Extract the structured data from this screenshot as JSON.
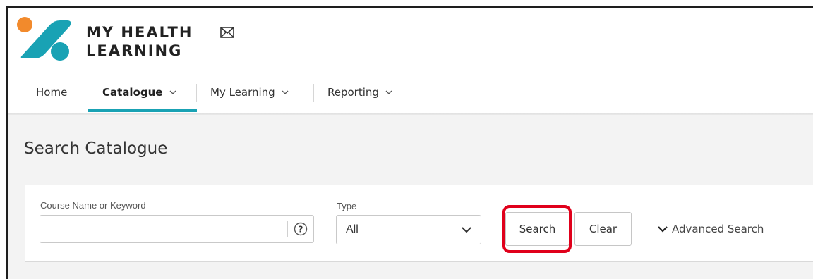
{
  "app": {
    "brand_line1": "MY HEALTH",
    "brand_line2": "LEARNING",
    "colors": {
      "accent_teal": "#19a2b4",
      "logo_orange": "#f28a2c",
      "highlight_red": "#e0001b"
    },
    "icons": {
      "mail": "mail-icon",
      "help": "help-circle-icon"
    }
  },
  "nav": {
    "items": [
      {
        "label": "Home",
        "active": false
      },
      {
        "label": "Catalogue",
        "active": true,
        "dropdown": true
      },
      {
        "label": "My Learning",
        "active": false,
        "dropdown": true
      },
      {
        "label": "Reporting",
        "active": false,
        "dropdown": true
      }
    ]
  },
  "page": {
    "title": "Search Catalogue",
    "search": {
      "keyword_label": "Course Name or Keyword",
      "keyword_value": "",
      "type_label": "Type",
      "type_value": "All",
      "search_button": "Search",
      "clear_button": "Clear",
      "advanced_search": "Advanced Search"
    }
  }
}
